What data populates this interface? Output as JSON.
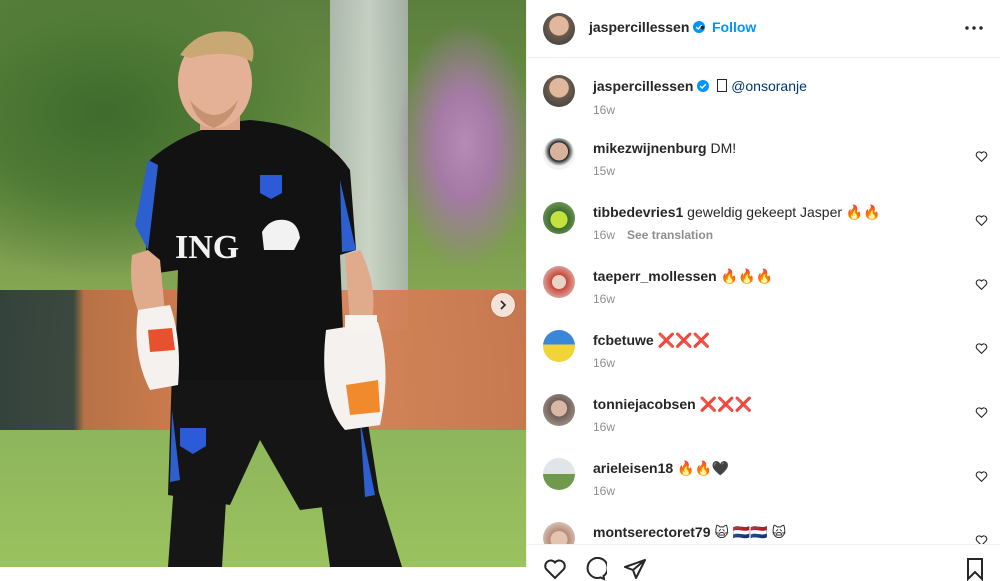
{
  "post": {
    "author": "jaspercillessen",
    "follow_label": "Follow",
    "dot": "•",
    "caption": {
      "username": "jaspercillessen",
      "text_prefix": "⁠",
      "mention": "@onsoranje",
      "time": "16w"
    }
  },
  "photo": {
    "jersey_text": "ING"
  },
  "comments": [
    {
      "username": "mikezwijnenburg",
      "text": "DM!",
      "time": "15w",
      "translate": ""
    },
    {
      "username": "tibbedevries1",
      "text": "geweldig gekeept Jasper 🔥🔥",
      "time": "16w",
      "translate": "See translation"
    },
    {
      "username": "taeperr_mollessen",
      "text": "🔥🔥🔥",
      "time": "16w",
      "translate": ""
    },
    {
      "username": "fcbetuwe",
      "text": "❌❌❌",
      "time": "16w",
      "translate": ""
    },
    {
      "username": "tonniejacobsen",
      "text": "❌❌❌",
      "time": "16w",
      "translate": ""
    },
    {
      "username": "arieleisen18",
      "text": "🔥🔥🖤",
      "time": "16w",
      "translate": ""
    },
    {
      "username": "montserectoret79",
      "text": "🙀 🇳🇱🇳🇱 🙀",
      "time": "",
      "translate": ""
    }
  ],
  "colors": {
    "accent": "#0095f6",
    "verified": "#0095f6",
    "muted": "#8e8e8e"
  },
  "icons": [
    "verified-badge-icon",
    "more-options-icon",
    "heart-icon",
    "chevron-right-icon",
    "comment-icon",
    "share-icon",
    "save-icon"
  ]
}
